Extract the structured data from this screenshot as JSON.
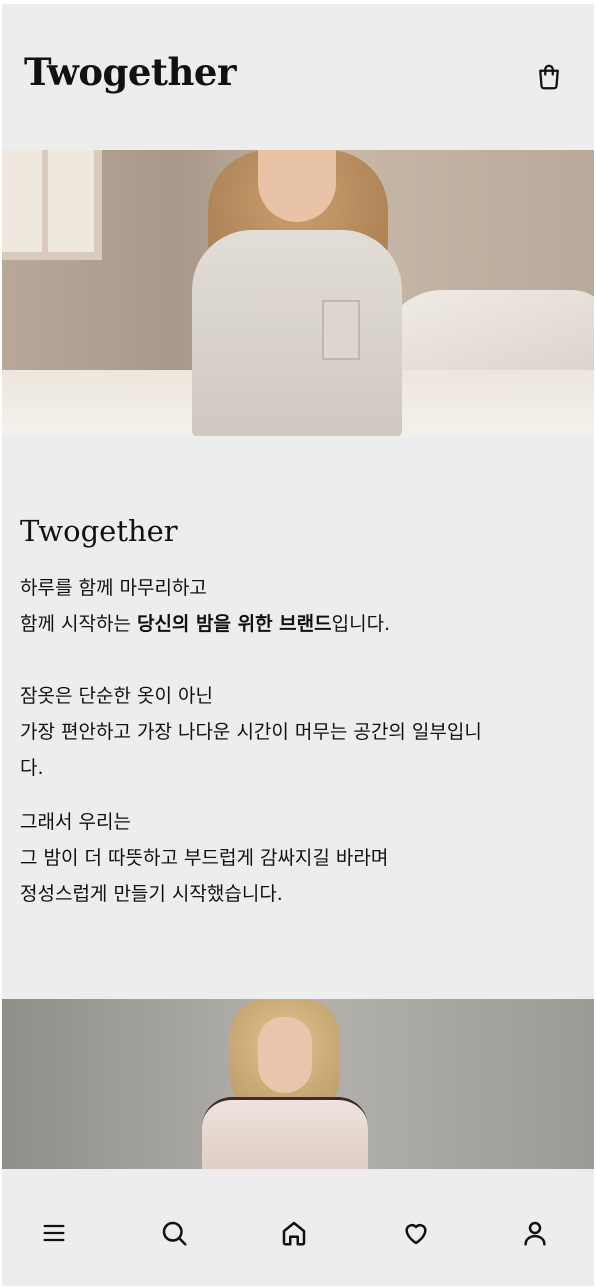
{
  "header": {
    "logo": "Twogether",
    "cart_icon": "shopping-bag-icon"
  },
  "hero": {
    "image": "woman-in-pajamas-on-bed-photo"
  },
  "intro": {
    "title": "Twogether",
    "p1_line1": "하루를 함께 마무리하고",
    "p1_line2_start": "함께 시작하는 ",
    "p1_line2_bold": "당신의 밤을 위한 브랜드",
    "p1_line2_end": "입니다.",
    "p2_line1": "잠옷은 단순한 옷이 아닌",
    "p2_line2": "가장 편안하고 가장 나다운 시간이 머무는 공간의 일부입니",
    "p2_line3": "다.",
    "p3_line1": "그래서 우리는",
    "p3_line2": "그 밤이 더 따뜻하고 부드럽게 감싸지길 바라며",
    "p3_line3": "정성스럽게 만들기 시작했습니다."
  },
  "photo2": {
    "image": "woman-in-satin-pajamas-photo"
  },
  "tabbar": {
    "items": [
      {
        "name": "menu",
        "icon": "menu-icon"
      },
      {
        "name": "search",
        "icon": "search-icon"
      },
      {
        "name": "home",
        "icon": "home-icon"
      },
      {
        "name": "wishlist",
        "icon": "heart-icon"
      },
      {
        "name": "account",
        "icon": "user-icon"
      }
    ]
  }
}
